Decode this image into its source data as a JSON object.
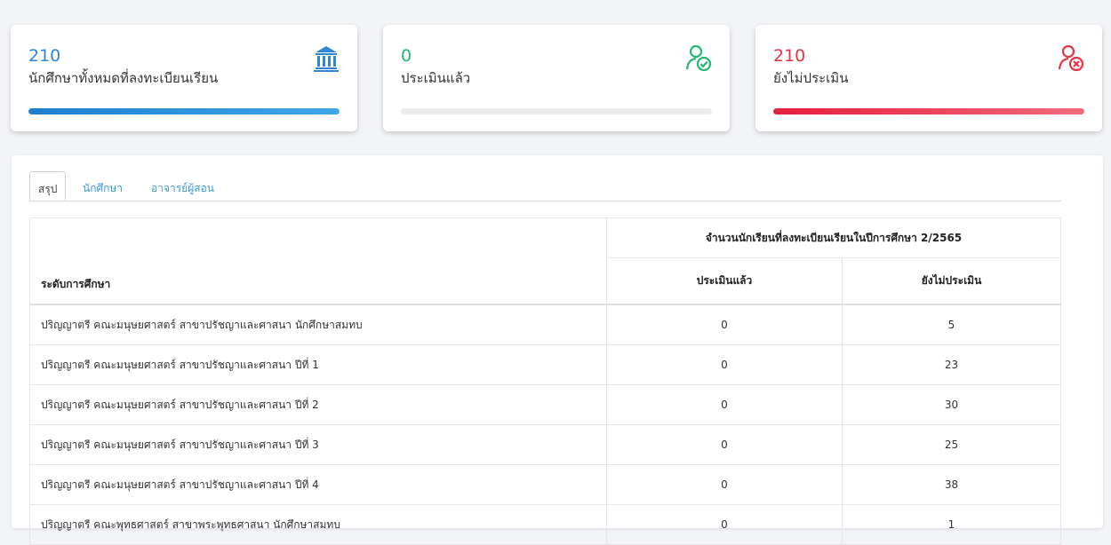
{
  "cards": [
    {
      "value": "210",
      "label": "นักศึกษาทั้งหมดที่ลงทะเบียนเรียน",
      "icon": "bank-icon",
      "color": "#2f86d6",
      "progress": 1.0
    },
    {
      "value": "0",
      "label": "ประเมินแล้ว",
      "icon": "user-check-icon",
      "color": "#23b873",
      "progress": 0.0
    },
    {
      "value": "210",
      "label": "ยังไม่ประเมิน",
      "icon": "user-remove-icon",
      "color": "#e63448",
      "progress": 1.0
    }
  ],
  "tabs": [
    "สรุป",
    "นักศึกษา",
    "อาจารย์ผู้สอน"
  ],
  "table": {
    "level_header": "ระดับการศึกษา",
    "group_header": "จำนวนนักเรียนที่ลงทะเบียนเรียนในปีการศึกษา 2/2565",
    "col_evaluated": "ประเมินแล้ว",
    "col_not_evaluated": "ยังไม่ประเมิน",
    "rows": [
      {
        "name": "ปริญญาตรี คณะมนุษยศาสตร์ สาขาปรัชญาและศาสนา นักศึกษาสมทบ",
        "evaluated": "0",
        "not_evaluated": "5"
      },
      {
        "name": "ปริญญาตรี คณะมนุษยศาสตร์ สาขาปรัชญาและศาสนา ปีที่ 1",
        "evaluated": "0",
        "not_evaluated": "23"
      },
      {
        "name": "ปริญญาตรี คณะมนุษยศาสตร์ สาขาปรัชญาและศาสนา ปีที่ 2",
        "evaluated": "0",
        "not_evaluated": "30"
      },
      {
        "name": "ปริญญาตรี คณะมนุษยศาสตร์ สาขาปรัชญาและศาสนา ปีที่ 3",
        "evaluated": "0",
        "not_evaluated": "25"
      },
      {
        "name": "ปริญญาตรี คณะมนุษยศาสตร์ สาขาปรัชญาและศาสนา ปีที่ 4",
        "evaluated": "0",
        "not_evaluated": "38"
      },
      {
        "name": "ปริญญาตรี คณะพุทธศาสตร์ สาขาพระพุทธศาสนา นักศึกษาสมทบ",
        "evaluated": "0",
        "not_evaluated": "1"
      }
    ]
  }
}
